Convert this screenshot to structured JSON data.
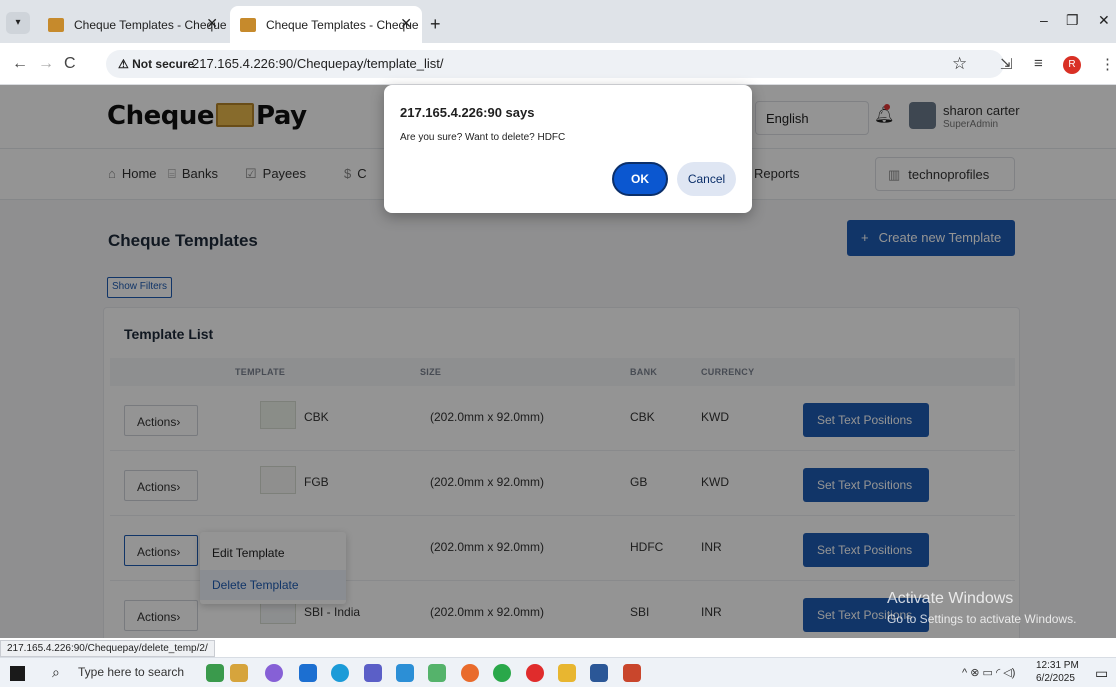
{
  "browser": {
    "tabs": [
      {
        "title": "Cheque Templates - Cheque Pa",
        "close": "✕"
      },
      {
        "title": "Cheque Templates - Cheque Pa",
        "close": "✕"
      }
    ],
    "tab_menu": "▾",
    "new_tab": "+",
    "window_controls": {
      "minimize": "–",
      "restore": "❐",
      "close": "✕"
    },
    "nav": {
      "back": "←",
      "forward": "→",
      "reload": "C"
    },
    "security_label": "⚠ Not secure",
    "url": "217.165.4.226:90/Chequepay/template_list/",
    "bookmark_icon": "☆",
    "extensions_icon": "⇲",
    "sidebar_icon": "≡",
    "profile_initial": "R",
    "menu_icon": "⋮"
  },
  "app": {
    "logo_left": "Cheque",
    "logo_right": "Pay",
    "language": "English",
    "user_name": "sharon carter",
    "user_role": "SuperAdmin",
    "menu": [
      {
        "icon": "⌂",
        "label": "Home"
      },
      {
        "icon": "⌸",
        "label": "Banks"
      },
      {
        "icon": "☑",
        "label": "Payees"
      },
      {
        "icon": "$",
        "label": "C"
      },
      {
        "icon": "",
        "label": "Reports"
      }
    ],
    "organization": "technoprofiles",
    "page_title": "Cheque Templates",
    "create_button": "Create new Template",
    "show_filters": "Show Filters",
    "card_title": "Template List",
    "columns": [
      "TEMPLATE",
      "SIZE",
      "BANK",
      "CURRENCY"
    ],
    "rows": [
      {
        "actions": "Actions›",
        "template": "CBK",
        "size": "(202.0mm x 92.0mm)",
        "bank": "CBK",
        "currency": "KWD",
        "button": "Set Text Positions"
      },
      {
        "actions": "Actions›",
        "template": "FGB",
        "size": "(202.0mm x 92.0mm)",
        "bank": "GB",
        "currency": "KWD",
        "button": "Set Text Positions"
      },
      {
        "actions": "Actions›",
        "template": "",
        "size": "(202.0mm x 92.0mm)",
        "bank": "HDFC",
        "currency": "INR",
        "button": "Set Text Positions"
      },
      {
        "actions": "Actions›",
        "template": "SBI - India",
        "size": "(202.0mm x 92.0mm)",
        "bank": "SBI",
        "currency": "INR",
        "button": "Set Text Positions"
      }
    ],
    "dropdown": {
      "edit": "Edit Template",
      "delete": "Delete Template"
    }
  },
  "dialog": {
    "title": "217.165.4.226:90 says",
    "message": "Are you sure? Want to delete? HDFC",
    "ok": "OK",
    "cancel": "Cancel"
  },
  "status_url": "217.165.4.226:90/Chequepay/delete_temp/2/",
  "watermark": {
    "line1": "Activate Windows",
    "line2": "Go to Settings to activate Windows."
  },
  "taskbar": {
    "search_placeholder": "Type here to search",
    "time": "12:31 PM",
    "date": "6/2/2025",
    "tray_icons": "^ ⊗ ▭ ◜ ◁)"
  },
  "colors": {
    "primary": "#1e5cb3",
    "dialog_ok": "#0b57d0"
  }
}
